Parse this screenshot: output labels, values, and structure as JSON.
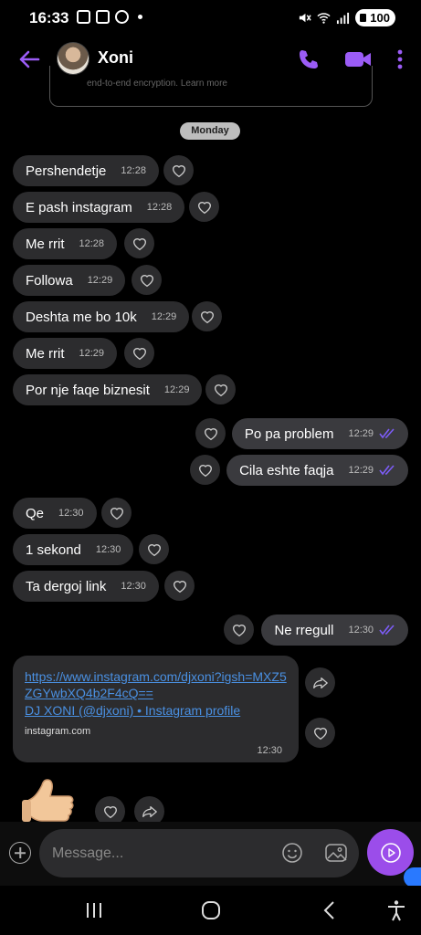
{
  "status_bar": {
    "time": "16:33",
    "battery": "100"
  },
  "header": {
    "contact_name": "Xoni",
    "accent_color": "#9b5cf6"
  },
  "notice": {
    "text": "end-to-end encryption. Learn more"
  },
  "day_separator": "Monday",
  "messages": [
    {
      "dir": "in",
      "text": "Pershendetje",
      "time": "12:28"
    },
    {
      "dir": "in",
      "text": "E pash instagram",
      "time": "12:28"
    },
    {
      "dir": "in",
      "text": "Me rrit",
      "time": "12:28"
    },
    {
      "dir": "in",
      "text": "Followa",
      "time": "12:29"
    },
    {
      "dir": "in",
      "text": "Deshta me bo 10k",
      "time": "12:29"
    },
    {
      "dir": "in",
      "text": "Me rrit",
      "time": "12:29"
    },
    {
      "dir": "in",
      "text": "Por nje faqe biznesit",
      "time": "12:29"
    },
    {
      "dir": "out",
      "text": "Po pa problem",
      "time": "12:29"
    },
    {
      "dir": "out",
      "text": "Cila eshte faqja",
      "time": "12:29"
    },
    {
      "dir": "in",
      "text": "Qe",
      "time": "12:30"
    },
    {
      "dir": "in",
      "text": "1 sekond",
      "time": "12:30"
    },
    {
      "dir": "in",
      "text": "Ta dergoj link",
      "time": "12:30"
    },
    {
      "dir": "out",
      "text": "Ne rregull",
      "time": "12:30"
    }
  ],
  "link_message": {
    "url": "https://www.instagram.com/djxoni?igsh=MXZ5ZGYwbXQ4b2F4cQ==",
    "title": "DJ XONI      (@djxoni) • Instagram profile",
    "domain": "instagram.com",
    "time": "12:30"
  },
  "composer": {
    "placeholder": "Message..."
  },
  "icons": {
    "back": "back-arrow-icon",
    "call": "phone-icon",
    "video": "video-icon",
    "more": "more-vertical-icon",
    "react": "heart-icon",
    "forward": "forward-icon",
    "emoji": "emoji-icon",
    "sticker": "sticker-icon",
    "send": "send-icon"
  }
}
